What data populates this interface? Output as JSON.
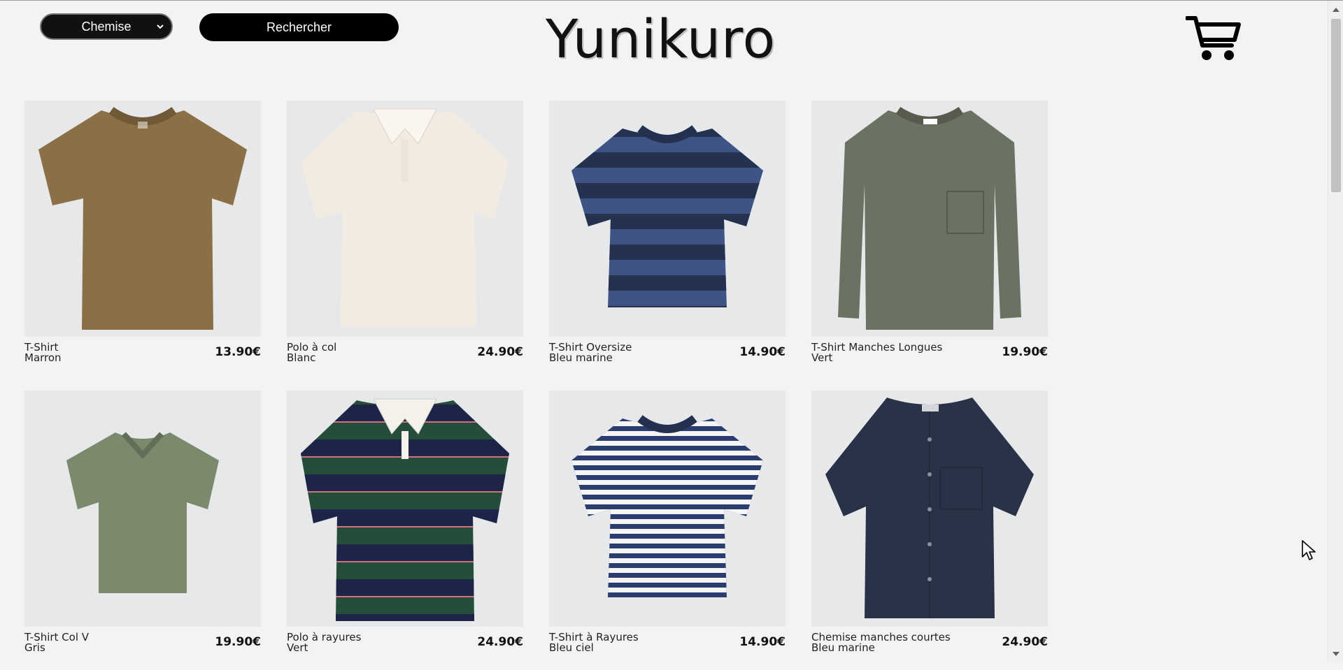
{
  "header": {
    "category_select": {
      "value": "Chemise"
    },
    "search_button_label": "Rechercher",
    "brand": "Yunikuro",
    "cart_icon": "shopping-cart-icon"
  },
  "colors": {
    "background": "#f3f3f3",
    "button_bg": "#000000",
    "button_text": "#ffffff",
    "image_bg": "#e6e8ea"
  },
  "products": [
    {
      "name": "T-Shirt",
      "color": "Marron",
      "price": "13.90€",
      "garment": "tshirt",
      "swatch": "#8b6f45"
    },
    {
      "name": "Polo à col",
      "color": "Blanc",
      "price": "24.90€",
      "garment": "polo",
      "swatch": "#f1ebe2"
    },
    {
      "name": "T-Shirt Oversize",
      "color": "Bleu marine",
      "price": "14.90€",
      "garment": "tshirt-stripe-wide",
      "swatch": "#3e5485"
    },
    {
      "name": "T-Shirt Manches Longues",
      "color": "Vert",
      "price": "19.90€",
      "garment": "longsleeve",
      "swatch": "#6b7262"
    },
    {
      "name": "T-Shirt Col V",
      "color": "Gris",
      "price": "19.90€",
      "garment": "vneck",
      "swatch": "#7b8a6d"
    },
    {
      "name": "Polo à rayures",
      "color": "Vert",
      "price": "24.90€",
      "garment": "rugby",
      "swatch": "#244d3a"
    },
    {
      "name": "T-Shirt à Rayures",
      "color": "Bleu ciel",
      "price": "14.90€",
      "garment": "tshirt-stripe-thin",
      "swatch": "#2b3d6e"
    },
    {
      "name": "Chemise manches courtes",
      "color": "Bleu marine",
      "price": "24.90€",
      "garment": "shirt",
      "swatch": "#2a3247"
    }
  ]
}
